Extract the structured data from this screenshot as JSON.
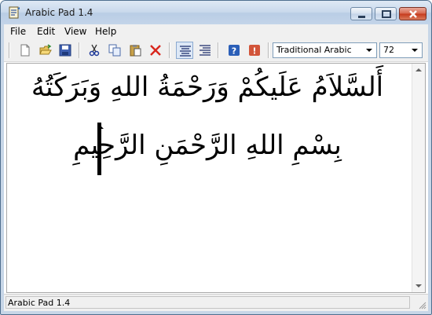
{
  "window": {
    "title": "Arabic Pad 1.4",
    "icon": "app-icon"
  },
  "window_buttons": [
    "minimize-icon",
    "maximize-icon",
    "close-icon"
  ],
  "menu": [
    "File",
    "Edit",
    "View",
    "Help"
  ],
  "toolbar": {
    "buttons": [
      "new-document-icon",
      "open-folder-icon",
      "save-icon",
      "cut-icon",
      "copy-icon",
      "paste-icon",
      "delete-icon",
      "align-left-icon",
      "align-right-icon",
      "help-icon",
      "about-icon"
    ],
    "font_name": "Traditional Arabic",
    "font_size": "72"
  },
  "editor": {
    "lines": [
      "أَلسَّلاَمُ عَلَيكُمْ وَرَحْمَةُ اللهِ وَبَرَكَتُهُ",
      "بِسْمِ اللهِ الرَّحْمَنِ الرَّحِيمِ"
    ]
  },
  "status": {
    "text": "Arabic Pad 1.4"
  }
}
